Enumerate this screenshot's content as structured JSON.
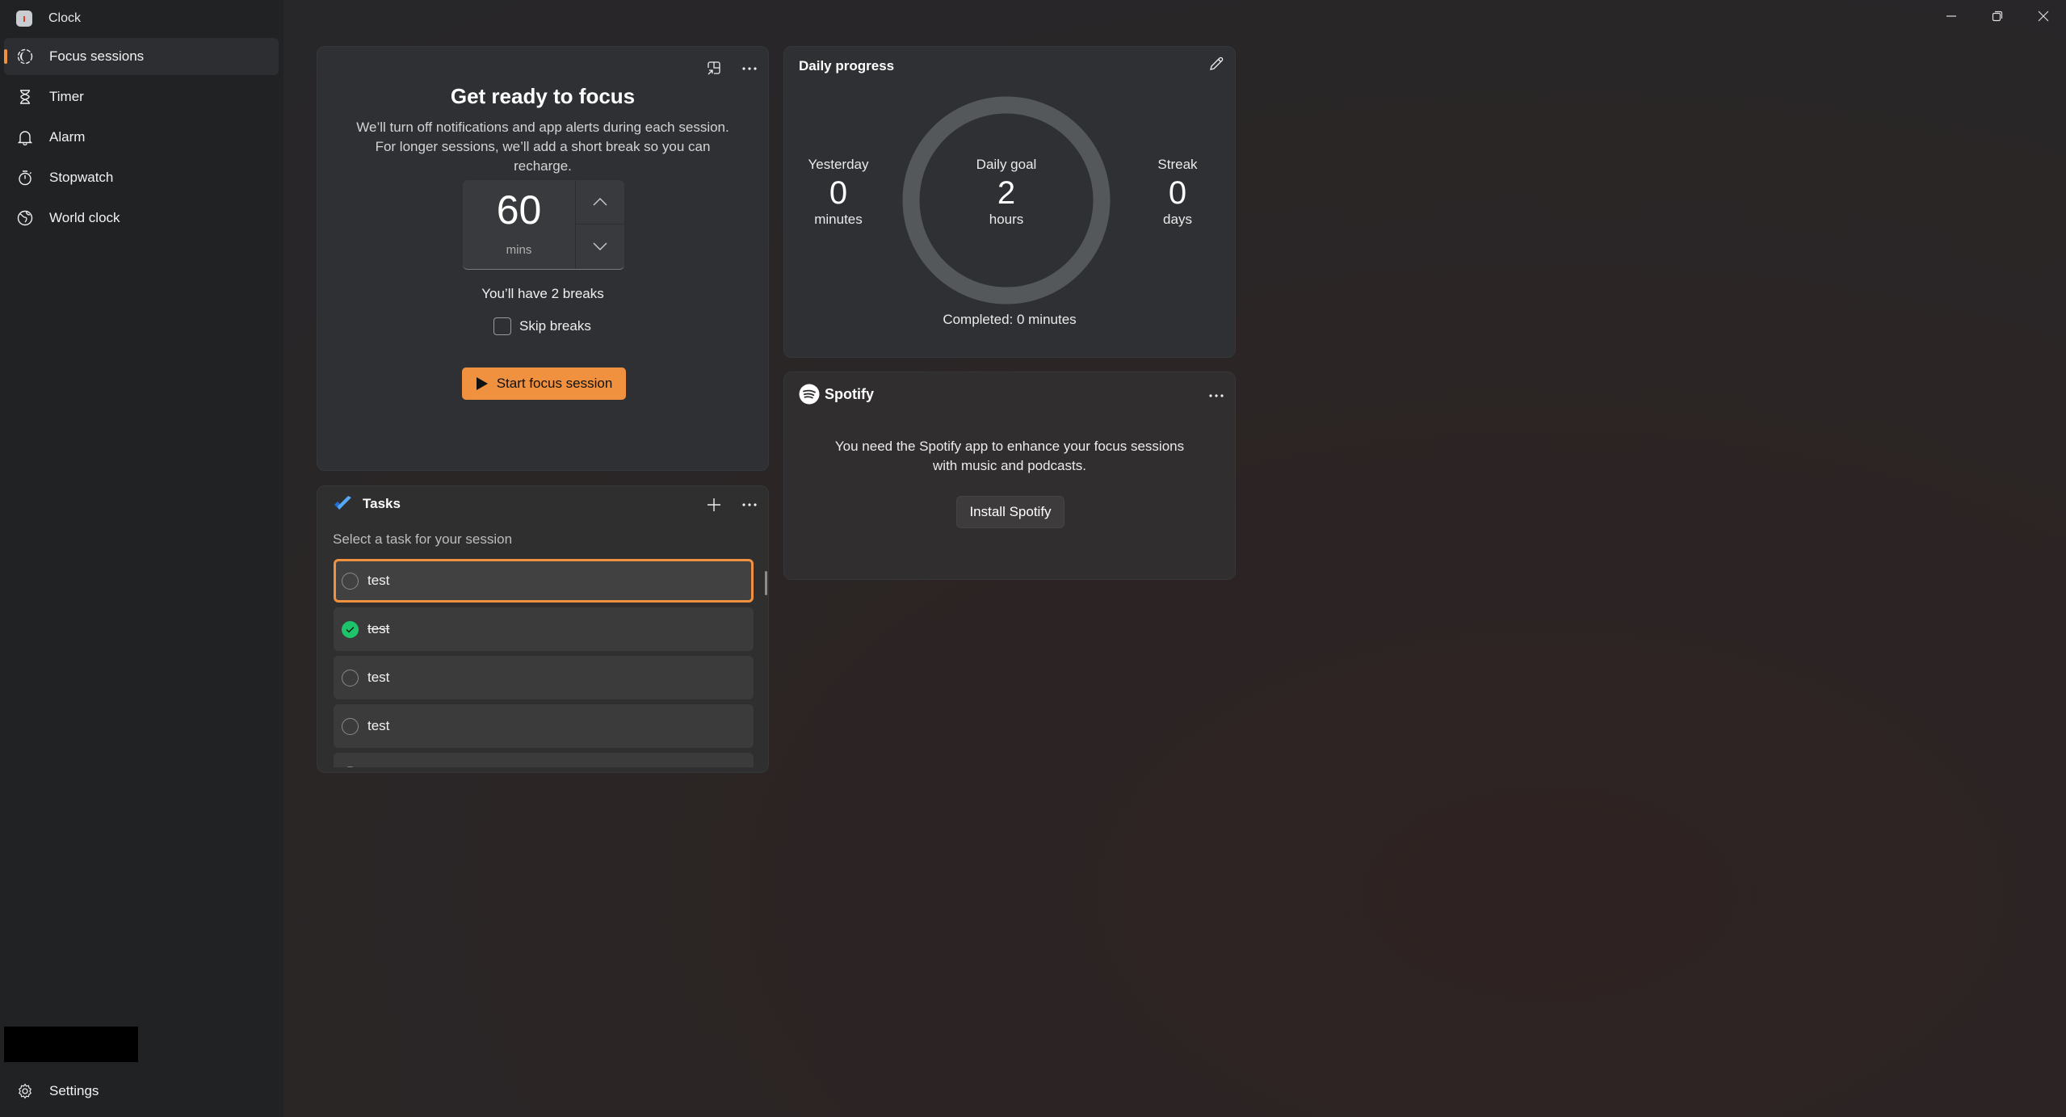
{
  "window": {
    "app_title": "Clock",
    "controls": {
      "minimize": "minimize-icon",
      "restore": "restore-icon",
      "close": "close-icon"
    }
  },
  "sidebar": {
    "items": [
      {
        "label": "Focus sessions",
        "icon": "focus-icon",
        "active": true
      },
      {
        "label": "Timer",
        "icon": "hourglass-icon",
        "active": false
      },
      {
        "label": "Alarm",
        "icon": "bell-icon",
        "active": false
      },
      {
        "label": "Stopwatch",
        "icon": "stopwatch-icon",
        "active": false
      },
      {
        "label": "World clock",
        "icon": "globe-icon",
        "active": false
      }
    ],
    "settings_label": "Settings"
  },
  "focus": {
    "title": "Get ready to focus",
    "description": "We’ll turn off notifications and app alerts during each session. For longer sessions, we’ll add a short break so you can recharge.",
    "duration_value": "60",
    "duration_unit": "mins",
    "breaks_text": "You’ll have 2 breaks",
    "skip_breaks_label": "Skip breaks",
    "skip_breaks_checked": false,
    "start_label": "Start focus session"
  },
  "tasks": {
    "title": "Tasks",
    "subtitle": "Select a task for your session",
    "items": [
      {
        "label": "test",
        "done": false,
        "selected": true
      },
      {
        "label": "test",
        "done": true,
        "selected": false
      },
      {
        "label": "test",
        "done": false,
        "selected": false
      },
      {
        "label": "test",
        "done": false,
        "selected": false
      },
      {
        "label": "",
        "done": false,
        "selected": false
      }
    ]
  },
  "progress": {
    "title": "Daily progress",
    "yesterday": {
      "label": "Yesterday",
      "value": "0",
      "unit": "minutes"
    },
    "goal": {
      "label": "Daily goal",
      "value": "2",
      "unit": "hours"
    },
    "streak": {
      "label": "Streak",
      "value": "0",
      "unit": "days"
    },
    "completed_text": "Completed: 0 minutes",
    "goal_fraction_complete": 0
  },
  "spotify": {
    "brand": "Spotify",
    "message": "You need the Spotify app to enhance your focus sessions with music and podcasts.",
    "install_label": "Install Spotify"
  },
  "colors": {
    "accent": "#f0913f",
    "done_green": "#1ec46a",
    "ring_track": "#55585a"
  }
}
